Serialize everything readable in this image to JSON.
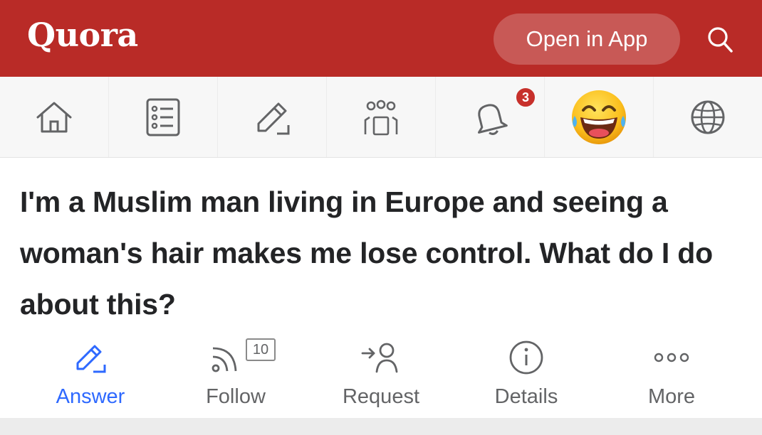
{
  "header": {
    "logo": "Quora",
    "open_in_app": "Open in App",
    "search_icon": "search-icon",
    "background": "#b92b27"
  },
  "nav": {
    "items": [
      {
        "icon": "home-icon"
      },
      {
        "icon": "answer-list-icon"
      },
      {
        "icon": "write-icon"
      },
      {
        "icon": "spaces-icon"
      },
      {
        "icon": "notifications-bell-icon",
        "badge": "3"
      },
      {
        "icon": "laughing-emoji-avatar"
      },
      {
        "icon": "globe-icon"
      }
    ]
  },
  "question": {
    "text": "I'm a Muslim man living in Europe and seeing a woman's hair makes me lose control. What do I do about this?"
  },
  "actions": {
    "answer": {
      "label": "Answer",
      "icon": "pencil-icon",
      "color": "#2e69ff"
    },
    "follow": {
      "label": "Follow",
      "icon": "rss-feed-icon",
      "count": "10"
    },
    "request": {
      "label": "Request",
      "icon": "request-person-icon"
    },
    "details": {
      "label": "Details",
      "icon": "info-icon"
    },
    "more": {
      "label": "More",
      "icon": "more-dots-icon"
    }
  }
}
